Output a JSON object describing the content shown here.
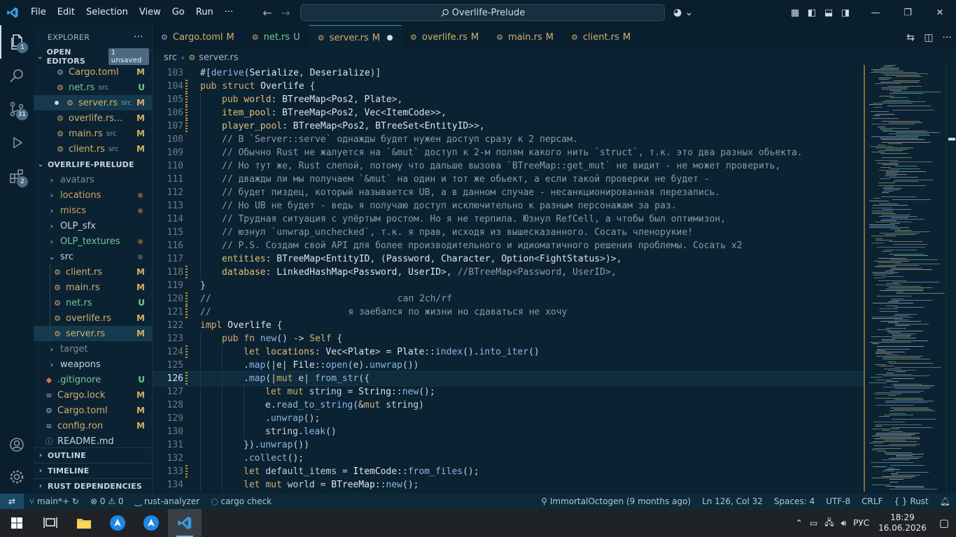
{
  "menu": [
    "File",
    "Edit",
    "Selection",
    "View",
    "Go",
    "Run",
    "···"
  ],
  "command_center": "Overlife-Prelude",
  "explorer": {
    "title": "EXPLORER",
    "open_editors_label": "OPEN EDITORS",
    "unsaved_label": "1 unsaved",
    "open_editors": [
      {
        "name": "Cargo.toml",
        "hint": "",
        "status": "M"
      },
      {
        "name": "net.rs",
        "hint": "src",
        "status": "U"
      },
      {
        "name": "server.rs",
        "hint": "src",
        "status": "M"
      },
      {
        "name": "overlife.rs...",
        "hint": "",
        "status": "M"
      },
      {
        "name": "main.rs",
        "hint": "src",
        "status": "M"
      },
      {
        "name": "client.rs",
        "hint": "src",
        "status": "M"
      }
    ],
    "project_label": "OVERLIFE-PRELUDE",
    "tree": [
      {
        "name": "avatars",
        "status": ""
      },
      {
        "name": "locations",
        "status": ""
      },
      {
        "name": "miscs",
        "status": ""
      },
      {
        "name": "OLP_sfx",
        "status": ""
      },
      {
        "name": "OLP_textures",
        "status": ""
      },
      {
        "name": "src",
        "status": ""
      },
      {
        "name": "client.rs",
        "status": "M"
      },
      {
        "name": "main.rs",
        "status": "M"
      },
      {
        "name": "net.rs",
        "status": "U"
      },
      {
        "name": "overlife.rs",
        "status": "M"
      },
      {
        "name": "server.rs",
        "status": "M"
      },
      {
        "name": "target",
        "status": ""
      },
      {
        "name": "weapons",
        "status": ""
      },
      {
        "name": ".gitignore",
        "status": "U"
      },
      {
        "name": "Cargo.lock",
        "status": "M"
      },
      {
        "name": "Cargo.toml",
        "status": "M"
      },
      {
        "name": "config.ron",
        "status": "M"
      },
      {
        "name": "README.md",
        "status": ""
      }
    ],
    "outline_label": "OUTLINE",
    "timeline_label": "TIMELINE",
    "rust_deps_label": "RUST DEPENDENCIES"
  },
  "tabs": [
    {
      "name": "Cargo.toml",
      "status": "M"
    },
    {
      "name": "net.rs",
      "status": "U"
    },
    {
      "name": "server.rs",
      "status": "M"
    },
    {
      "name": "overlife.rs",
      "status": "M"
    },
    {
      "name": "main.rs",
      "status": "M"
    },
    {
      "name": "client.rs",
      "status": "M"
    }
  ],
  "breadcrumb": {
    "folder": "src",
    "file": "server.rs"
  },
  "code": {
    "line_numbers": [
      "103",
      "104",
      "105",
      "106",
      "107",
      "108",
      "109",
      "110",
      "111",
      "112",
      "113",
      "114",
      "115",
      "116",
      "117",
      "118",
      "119",
      "120",
      "121",
      "122",
      "123",
      "124",
      "125",
      "126",
      "127",
      "128",
      "129",
      "130",
      "131",
      "132",
      "133",
      "134"
    ],
    "lines": [
      "#[derive(Serialize, Deserialize)]",
      "pub struct Overlife {",
      "    pub world: BTreeMap<Pos2, Plate>,",
      "    item_pool: BTreeMap<Pos2, Vec<ItemCode>>,",
      "    player_pool: BTreeMap<Pos2, BTreeSet<EntityID>>,",
      "    // В `Server::serve` однажды будет нужен доступ сразу к 2 персам.",
      "    // Обычно Rust не жалуется на `&mut` доступ к 2-м полям какого нить `struct`, т.к. это два разных обьекта.",
      "    // Но тут же, Rust слепой, потому что дальше вызова `BTreeMap::get_mut` не видит - не может проверить,",
      "    // дважды ли мы получаем `&mut` на один и тот же обьект, а если такой проверки не будет -",
      "    // будет пиздец, который называется UB, а в данном случае - несанкционированная перезапись.",
      "    // Но UB не будет - ведь я получаю доступ исключительно к разным персонажам за раз.",
      "    // Трудная ситуация с упёртым ростом. Но я не терпила. Юзнул RefCell, а чтобы был оптимизон,",
      "    // юзнул `unwrap_unchecked`, т.к. я прав, исходя из вышесказанного. Сосать членорукие!",
      "    // P.S. Создам свой API для более производительного и идиоматичного решения проблемы. Сосать x2",
      "    entities: BTreeMap<EntityID, (Password, Character, Option<FightStatus>)>,",
      "    database: LinkedHashMap<Password, UserID>, //BTreeMap<Password, UserID>,",
      "}",
      "//                                  сап 2ch/rf",
      "//                         я заебался по жизни но сдаваться не хочу",
      "impl Overlife {",
      "    pub fn new() -> Self {",
      "        let locations: Vec<Plate> = Plate::index().into_iter()",
      "        .map(|e| File::open(e).unwrap())",
      "        .map(|mut e| from_str({",
      "            let mut string = String::new();",
      "            e.read_to_string(&mut string)",
      "            .unwrap();",
      "            string.leak()",
      "        }).unwrap())",
      "        .collect();",
      "        let default_items = ItemCode::from_files();",
      "        let mut world = BTreeMap::new();"
    ]
  },
  "status": {
    "branch": "main*+",
    "problems": "0",
    "warnings": "0",
    "analyzer": "rust-analyzer",
    "cargo": "cargo check",
    "blame": "ImmortalOctogen (9 months ago)",
    "position": "Ln 126, Col 32",
    "spaces": "Spaces: 4",
    "encoding": "UTF-8",
    "eol": "CRLF",
    "language": "Rust"
  },
  "taskbar": {
    "lang": "РУС",
    "time": "18:29",
    "date": "16.06.2026"
  },
  "badges": {
    "explorer": "1",
    "scm": "31",
    "extensions": "2"
  }
}
